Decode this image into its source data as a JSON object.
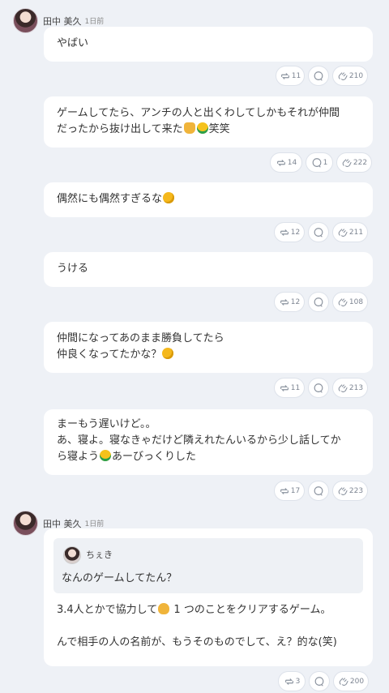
{
  "posts": [
    {
      "author": {
        "name": "田中 美久",
        "time": "1日前"
      },
      "messages": [
        {
          "lines": [
            "やばい"
          ],
          "reactions": {
            "repost": "11",
            "reply": "",
            "clap": "210"
          }
        },
        {
          "lines": [
            "ゲームしてたら、アンチの人と出くわしてしかもそれが仲間",
            "だったから抜け出して来た",
            "笑笑"
          ],
          "reactions": {
            "repost": "14",
            "reply": "1",
            "clap": "222"
          }
        },
        {
          "lines": [
            "偶然にも偶然すぎるな"
          ],
          "reactions": {
            "repost": "12",
            "reply": "",
            "clap": "211"
          }
        },
        {
          "lines": [
            "うける"
          ],
          "reactions": {
            "repost": "12",
            "reply": "",
            "clap": "108"
          }
        },
        {
          "lines": [
            "仲間になってあのまま勝負してたら",
            "仲良くなってたかな？"
          ],
          "reactions": {
            "repost": "11",
            "reply": "",
            "clap": "213"
          }
        },
        {
          "lines": [
            "まーもう遅いけど。。",
            "あ、寝よ。寝なきゃだけど隣えれたんいるから少し話してか",
            "ら寝よう",
            "あーびっくりした"
          ],
          "reactions": {
            "repost": "17",
            "reply": "",
            "clap": "223"
          }
        }
      ]
    },
    {
      "author": {
        "name": "田中 美久",
        "time": "1日前"
      },
      "quote": {
        "name": "ちぇき",
        "text": "なんのゲームしてたん？"
      },
      "lines": [
        "3.4人とかで協力して",
        " 1 つのことをクリアするゲーム。",
        "",
        "んで相手の人の名前が、もうそのものでして、え？的な(笑)"
      ],
      "reactions": {
        "repost": "3",
        "reply": "",
        "clap": "200"
      }
    }
  ],
  "icons": [
    "repost-icon",
    "reply-icon",
    "clap-icon",
    "thinking-emoji",
    "grin-emoji",
    "hand-emoji",
    "yellow-heart-emoji"
  ]
}
